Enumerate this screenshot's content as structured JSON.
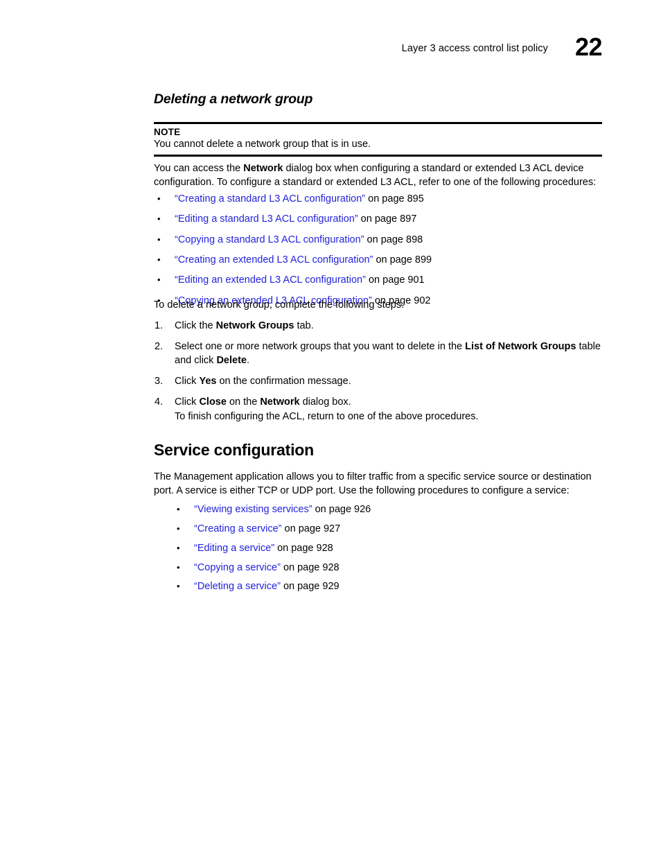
{
  "header": {
    "title": "Layer 3 access control list policy",
    "chapter": "22"
  },
  "subsection": {
    "heading": "Deleting a network group"
  },
  "note": {
    "label": "NOTE",
    "text": "You cannot delete a network group that is in use."
  },
  "intro": {
    "part1": "You can access the ",
    "bold1": "Network",
    "part2": " dialog box when configuring a standard or extended L3 ACL device configuration. To configure a standard or extended L3 ACL, refer to one of the following procedures:"
  },
  "acl_links": [
    {
      "title": "“Creating a standard L3 ACL configuration”",
      "page": " on page 895"
    },
    {
      "title": "“Editing a standard L3 ACL configuration”",
      "page": " on page 897"
    },
    {
      "title": "“Copying a standard L3 ACL configuration”",
      "page": " on page 898"
    },
    {
      "title": "“Creating an extended L3 ACL configuration”",
      "page": " on page 899"
    },
    {
      "title": "“Editing an extended L3 ACL configuration”",
      "page": " on page 901"
    },
    {
      "title": "“Copying an extended L3 ACL configuration”",
      "page": " on page 902"
    }
  ],
  "steps_intro": "To delete a network group, complete the following steps.",
  "steps": [
    {
      "num": "1.",
      "segments": [
        {
          "text": "Click the ",
          "bold": false
        },
        {
          "text": "Network Groups",
          "bold": true
        },
        {
          "text": " tab.",
          "bold": false
        }
      ]
    },
    {
      "num": "2.",
      "segments": [
        {
          "text": "Select one or more network groups that you want to delete in the ",
          "bold": false
        },
        {
          "text": "List of Network Groups",
          "bold": true
        },
        {
          "text": " table and click ",
          "bold": false
        },
        {
          "text": "Delete",
          "bold": true
        },
        {
          "text": ".",
          "bold": false
        }
      ]
    },
    {
      "num": "3.",
      "segments": [
        {
          "text": "Click ",
          "bold": false
        },
        {
          "text": "Yes",
          "bold": true
        },
        {
          "text": " on the confirmation message.",
          "bold": false
        }
      ]
    },
    {
      "num": "4.",
      "segments": [
        {
          "text": "Click ",
          "bold": false
        },
        {
          "text": "Close",
          "bold": true
        },
        {
          "text": " on the ",
          "bold": false
        },
        {
          "text": "Network",
          "bold": true
        },
        {
          "text": " dialog box.",
          "bold": false
        }
      ]
    }
  ],
  "steps_closing": "To finish configuring the ACL, return to one of the above procedures.",
  "section": {
    "heading": "Service configuration",
    "intro": "The Management application allows you to filter traffic from a specific service source or destination port. A service is either TCP or UDP port. Use the following procedures to configure a service:"
  },
  "service_links": [
    {
      "title": "“Viewing existing services”",
      "page": " on page 926"
    },
    {
      "title": "“Creating a service”",
      "page": " on page 927"
    },
    {
      "title": "“Editing a service”",
      "page": " on page 928"
    },
    {
      "title": "“Copying a service”",
      "page": " on page 928"
    },
    {
      "title": "“Deleting a service”",
      "page": " on page 929"
    }
  ],
  "bullet_glyph": "•",
  "colors": {
    "link": "#2222dd",
    "text": "#000000",
    "page_background": "#ffffff"
  }
}
